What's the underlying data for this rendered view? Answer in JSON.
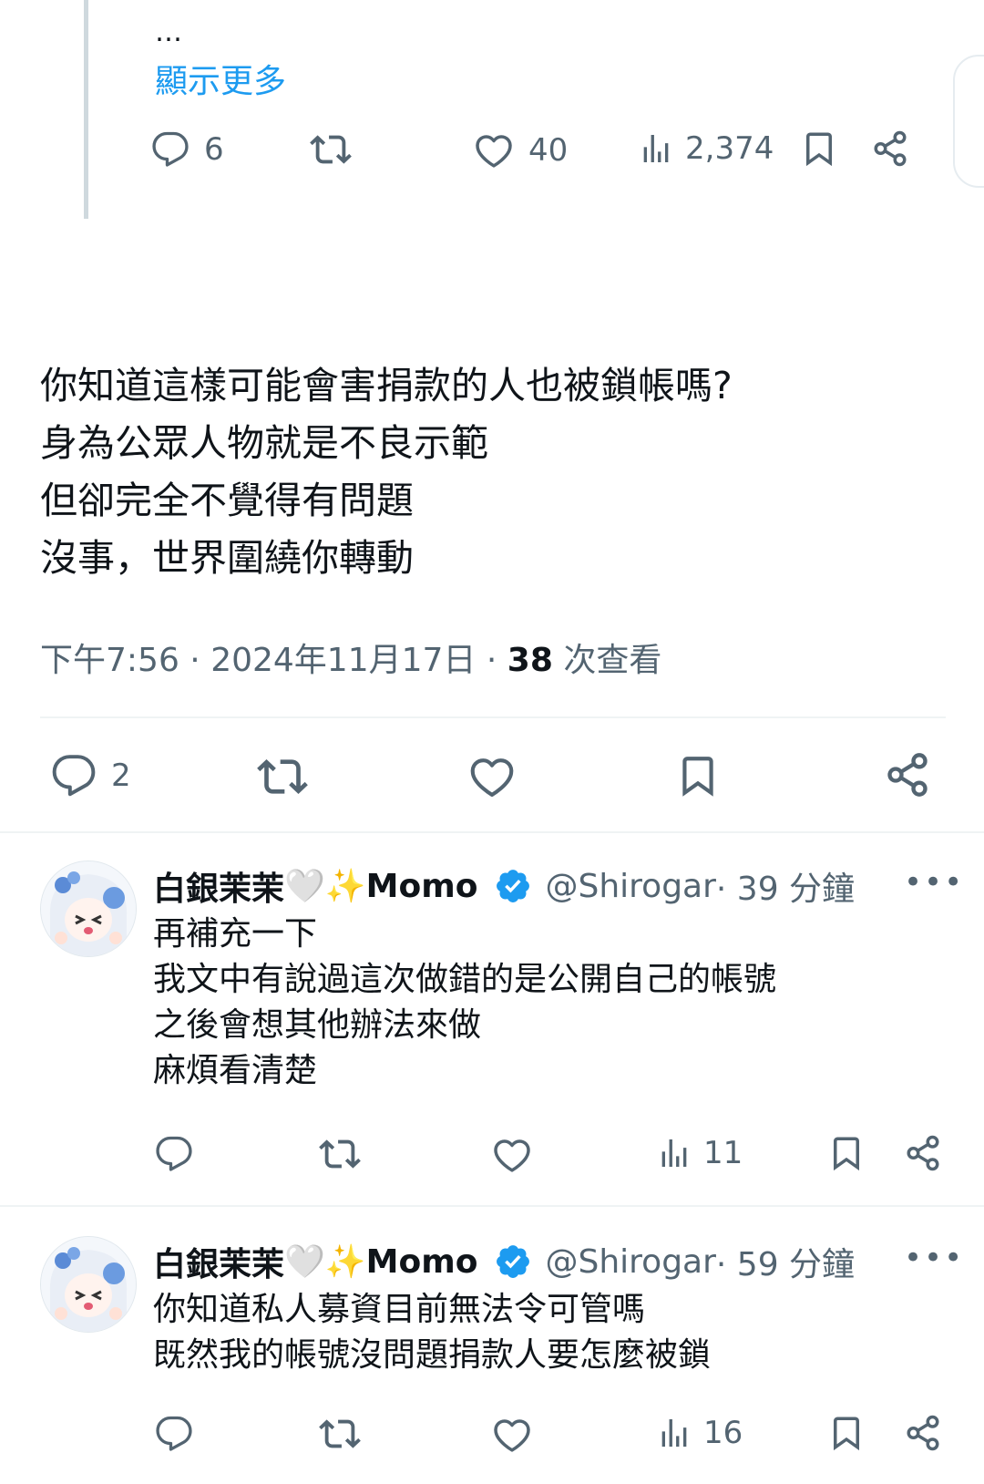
{
  "prev_tweet": {
    "ellipsis": "…",
    "show_more": "顯示更多",
    "actions": {
      "replies": "6",
      "likes": "40",
      "views": "2,374"
    }
  },
  "main_tweet": {
    "lines": [
      "你知道這樣可能會害捐款的人也被鎖帳嗎?",
      "身為公眾人物就是不良示範",
      "但卻完全不覺得有問題",
      "沒事，世界圍繞你轉動"
    ],
    "meta": {
      "time": "下午7:56",
      "sep1": " · ",
      "date": "2024年11月17日",
      "sep2": " · ",
      "views": "38",
      "views_label": " 次查看"
    },
    "actions": {
      "replies": "2"
    }
  },
  "replies": [
    {
      "display_name": "白銀茉茉",
      "name_emoji": "🤍✨",
      "name_suffix": "Momo",
      "handle": "@Shirogar",
      "time": " · 39 分鐘",
      "more": "•••",
      "lines": [
        "再補充一下",
        "我文中有說過這次做錯的是公開自己的帳號",
        "之後會想其他辦法來做",
        "麻煩看清楚"
      ],
      "views": "11"
    },
    {
      "display_name": "白銀茉茉",
      "name_emoji": "🤍✨",
      "name_suffix": "Momo",
      "handle": "@Shirogar",
      "time": " · 59 分鐘",
      "more": "•••",
      "lines": [
        "你知道私人募資目前無法令可管嗎",
        "既然我的帳號沒問題捐款人要怎麼被鎖"
      ],
      "views": "16"
    }
  ],
  "colors": {
    "accent": "#1d9bf0",
    "muted": "#536471",
    "text": "#0f1419",
    "verified": "#1d9bf0"
  },
  "icons": [
    "reply-icon",
    "retweet-icon",
    "like-icon",
    "views-icon",
    "bookmark-icon",
    "share-icon",
    "verified-icon",
    "more-icon"
  ]
}
